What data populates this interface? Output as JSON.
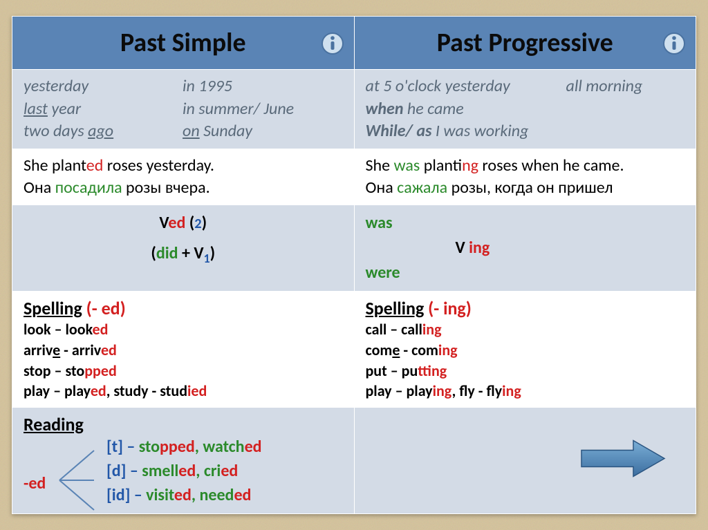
{
  "header": {
    "left": "Past Simple",
    "right": "Past Progressive"
  },
  "markers": {
    "left": {
      "l1a": "yesterday",
      "l1b": "in 1995",
      "l2a_pre": "last",
      "l2a_u": " year",
      "l2b": "in summer/ June",
      "l3a_pre": "two days ",
      "l3a_u": "ago",
      "l3b_u": "on",
      "l3b_post": " Sunday"
    },
    "right": {
      "l1a": "at 5 o'clock  yesterday",
      "l1b": "all morning",
      "l2_b": "when",
      "l2_rest": " he came",
      "l3_b": "While/ as",
      "l3_rest": " I was working"
    }
  },
  "example": {
    "left_en_pre": "She  plant",
    "left_en_ed": "ed",
    "left_en_post": " roses yesterday.",
    "left_ru_pre": "Она ",
    "left_ru_verb": "посадила",
    "left_ru_post": " розы вчера.",
    "right_en_1": "She ",
    "right_en_was": "was",
    "right_en_2": " plant",
    "right_en_ing": "ing",
    "right_en_3": " roses when he came.",
    "right_ru_pre": "Она ",
    "right_ru_verb": "сажала",
    "right_ru_post": " розы, когда он пришел"
  },
  "formula": {
    "left_ved_v": "V",
    "left_ved_ed": "ed",
    "left_ved_paren": " (",
    "left_ved_2": "2",
    "left_ved_close": ")",
    "left_did_open": "(",
    "left_did": "did",
    "left_did_mid": " + V",
    "left_did_1": "1",
    "left_did_close": ")",
    "right_was": "was",
    "right_v": "V ",
    "right_ing": "ing",
    "right_were": "were"
  },
  "spelling": {
    "left_title_a": "Spelling",
    "left_title_b": "  (- ed)",
    "l1a": "look – look",
    "l1b": "ed",
    "l2a_pre": "arriv",
    "l2a_u": "e",
    "l2a_mid": " - arriv",
    "l2a_ed": "ed",
    "l3a": "stop – sto",
    "l3b": "pp",
    "l3c": "ed",
    "l4a": "play – play",
    "l4b": "ed",
    "l4c": ", study - stud",
    "l4d": "ied",
    "right_title_a": "Spelling",
    "right_title_b": "  (- ing)",
    "r1a": "call – call",
    "r1b": "ing",
    "r2a_pre": "com",
    "r2a_u": "e",
    "r2a_mid": " - com",
    "r2a_ing": "ing",
    "r3a": "put – pu",
    "r3b": "tt",
    "r3c": "ing",
    "r4a": "play – play",
    "r4b": "ing",
    "r4c": ", fly - fly",
    "r4d": "ing"
  },
  "reading": {
    "title": "Reading",
    "ed": "-ed",
    "t_label": "[t] – ",
    "t_w1a": "sto",
    "t_w1b": "pp",
    "t_w1c": "ed",
    "t_sep": ", ",
    "t_w2a": "watch",
    "t_w2b": "ed",
    "d_label": "[d] – ",
    "d_w1a": "smell",
    "d_w1b": "ed",
    "d_sep": ", ",
    "d_w2a": "cri",
    "d_w2b": "ed",
    "id_label": "[id] – ",
    "id_w1a": "visit",
    "id_w1b": "ed",
    "id_sep": ", ",
    "id_w2a": "need",
    "id_w2b": "ed"
  }
}
